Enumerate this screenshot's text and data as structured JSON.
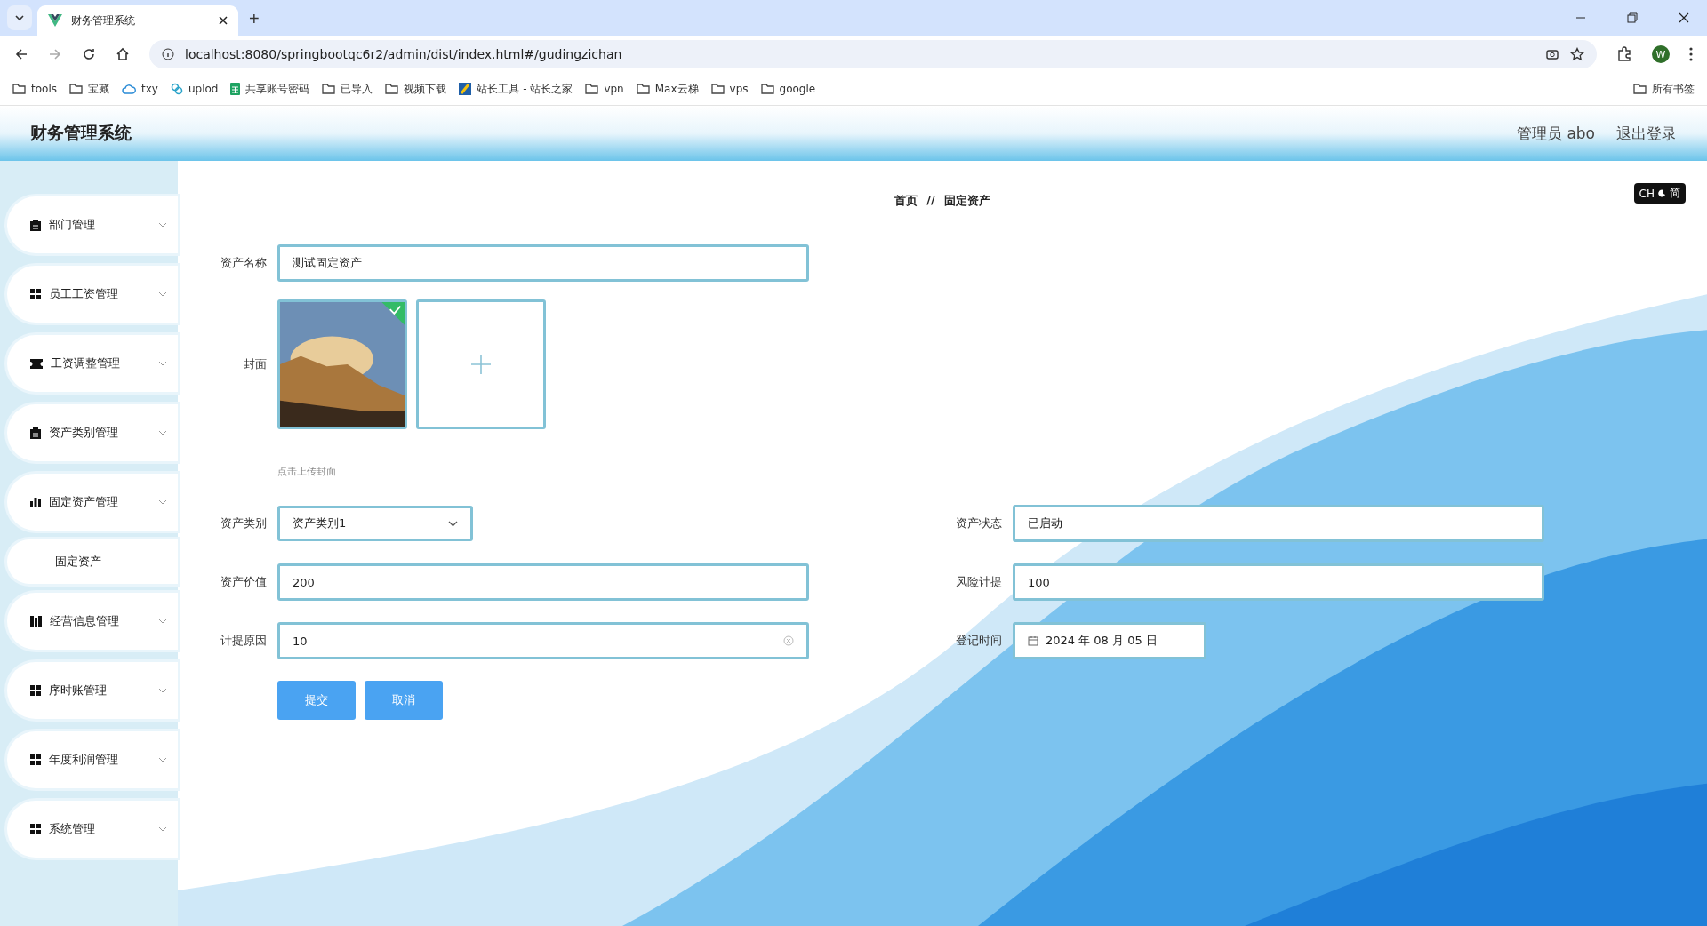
{
  "browser": {
    "tab_title": "财务管理系统",
    "new_tab": "+",
    "url": "localhost:8080/springbootqc6r2/admin/dist/index.html#/gudingzichan",
    "profile": "W",
    "bookmarks": [
      {
        "label": "tools",
        "kind": "folder"
      },
      {
        "label": "宝藏",
        "kind": "folder"
      },
      {
        "label": "txy",
        "kind": "cloud"
      },
      {
        "label": "uplod",
        "kind": "link"
      },
      {
        "label": "共享账号密码",
        "kind": "sheet"
      },
      {
        "label": "已导入",
        "kind": "folder"
      },
      {
        "label": "视频下载",
        "kind": "folder"
      },
      {
        "label": "站长工具 - 站长之家",
        "kind": "site"
      },
      {
        "label": "vpn",
        "kind": "folder"
      },
      {
        "label": "Max云梯",
        "kind": "folder"
      },
      {
        "label": "vps",
        "kind": "folder"
      },
      {
        "label": "google",
        "kind": "folder"
      }
    ],
    "all_bookmarks": "所有书签"
  },
  "header": {
    "title": "财务管理系统",
    "user": "管理员 abo",
    "logout": "退出登录"
  },
  "sidebar": {
    "items": [
      {
        "label": "部门管理",
        "kind": "group",
        "selected": false
      },
      {
        "label": "员工工资管理",
        "kind": "group",
        "selected": false
      },
      {
        "label": "工资调整管理",
        "kind": "group",
        "selected": false
      },
      {
        "label": "资产类别管理",
        "kind": "group",
        "selected": false
      },
      {
        "label": "固定资产管理",
        "kind": "group",
        "selected": false
      },
      {
        "label": "固定资产",
        "kind": "sub",
        "selected": true
      },
      {
        "label": "经营信息管理",
        "kind": "group",
        "selected": false
      },
      {
        "label": "序时账管理",
        "kind": "group",
        "selected": false
      },
      {
        "label": "年度利润管理",
        "kind": "group",
        "selected": false
      },
      {
        "label": "系统管理",
        "kind": "group",
        "selected": false
      }
    ]
  },
  "breadcrumb": [
    "首页",
    "固定资产"
  ],
  "breadcrumb_separator": "//",
  "ime_badge": {
    "mode": "CH",
    "script": "简"
  },
  "form": {
    "name": {
      "label": "资产名称",
      "value": "测试固定资产"
    },
    "cover": {
      "label": "封面",
      "uploaded": true,
      "hint": "点击上传封面"
    },
    "category": {
      "label": "资产类别",
      "value": "资产类别1"
    },
    "status": {
      "label": "资产状态",
      "value": "已启动"
    },
    "price": {
      "label": "资产价值",
      "value": "200"
    },
    "risk": {
      "label": "风险计提",
      "value": "100"
    },
    "reason": {
      "label": "计提原因",
      "value": "10"
    },
    "date": {
      "label": "登记时间",
      "value": "2024 年 08 月 05 日"
    },
    "buttons": [
      "提交",
      "取消"
    ]
  }
}
